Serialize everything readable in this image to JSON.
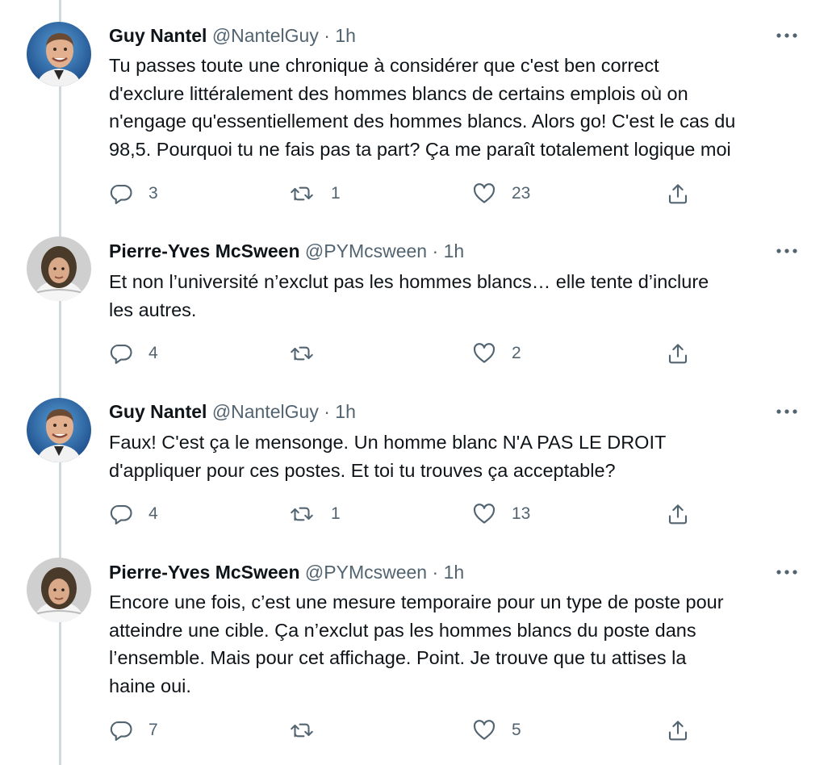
{
  "tweets": [
    {
      "name": "Guy Nantel",
      "handle": "@NantelGuy",
      "separator": "·",
      "time": "1h",
      "text": "Tu passes toute une chronique à considérer que c'est ben correct\nd'exclure littéralement des hommes blancs de certains emplois où on\nn'engage qu'essentiellement des hommes blancs. Alors go! C'est le cas du\n98,5. Pourquoi tu ne fais pas ta part? Ça me paraît totalement logique moi",
      "replies": "3",
      "retweets": "1",
      "likes": "23"
    },
    {
      "name": "Pierre-Yves McSween",
      "handle": "@PYMcsween",
      "separator": "·",
      "time": "1h",
      "text": "Et non l’université n’exclut pas les hommes blancs… elle tente d’inclure\nles autres.",
      "replies": "4",
      "retweets": "",
      "likes": "2"
    },
    {
      "name": "Guy Nantel",
      "handle": "@NantelGuy",
      "separator": "·",
      "time": "1h",
      "text": "Faux! C'est ça le mensonge. Un homme blanc N'A PAS LE DROIT\nd'appliquer pour ces postes. Et toi tu trouves ça acceptable?",
      "replies": "4",
      "retweets": "1",
      "likes": "13"
    },
    {
      "name": "Pierre-Yves McSween",
      "handle": "@PYMcsween",
      "separator": "·",
      "time": "1h",
      "text": "Encore une fois, c’est une mesure temporaire pour un type de poste pour\natteindre une cible. Ça n’exclut pas les hommes blancs du poste dans\nl’ensemble. Mais pour cet affichage. Point. Je trouve que tu attises la\nhaine oui.",
      "replies": "7",
      "retweets": "",
      "likes": "5"
    }
  ],
  "icons": {
    "reply": "reply-icon",
    "retweet": "retweet-icon",
    "like": "like-icon",
    "share": "share-icon",
    "more": "more-options-icon"
  },
  "colors": {
    "text": "#0f1419",
    "secondary": "#536471",
    "thread_line": "#cfd9de"
  }
}
